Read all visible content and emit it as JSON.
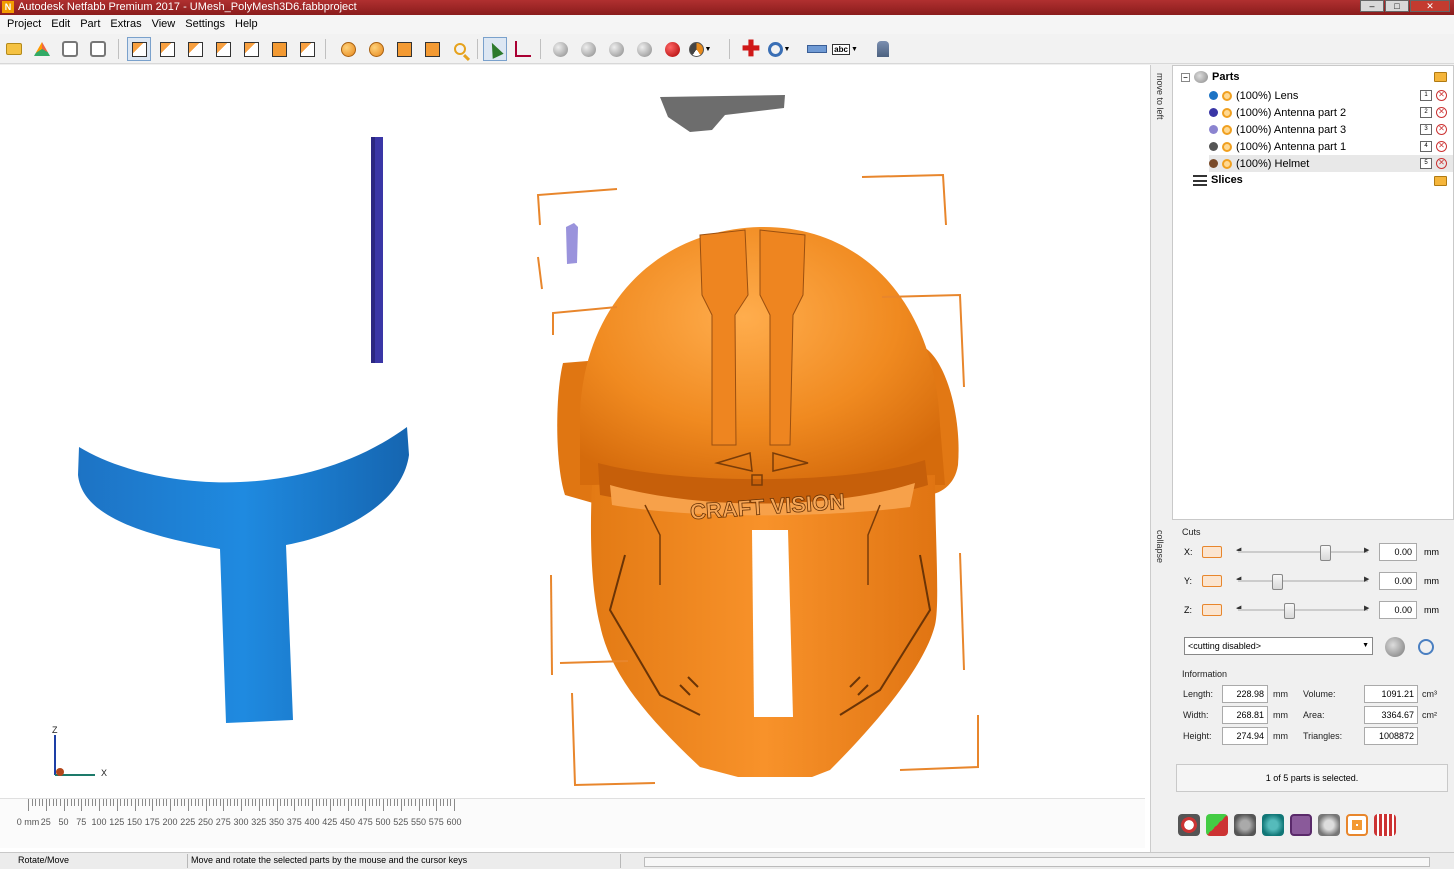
{
  "window": {
    "title": "Autodesk Netfabb Premium 2017 - UMesh_PolyMesh3D6.fabbproject",
    "app_icon_letter": "N"
  },
  "menu": [
    "Project",
    "Edit",
    "Part",
    "Extras",
    "View",
    "Settings",
    "Help"
  ],
  "toolbar_icons": [
    "open-project-icon",
    "add-part-icon",
    "settings-box-icon",
    "add-box-icon",
    "view-front-icon",
    "view-back-icon",
    "view-left-icon",
    "view-right-icon",
    "view-top-icon",
    "view-bottom-icon",
    "view-iso-icon",
    "repair-ball-icon",
    "sphere-icon",
    "fit-icon",
    "fit-selection-icon",
    "zoom-icon",
    "select-pointer-icon",
    "axes-icon",
    "shadow-sphere-icon",
    "gray-sphere-icon",
    "multi-sphere-icon",
    "mesh-sphere-icon",
    "color-spheres-icon",
    "pie-view-icon",
    "add-red-cross-icon",
    "dial-icon",
    "ruler-icon",
    "label-abc-icon",
    "person-icon"
  ],
  "side_strip": {
    "move_to_left": "move to left",
    "collapse": "collapse"
  },
  "tree": {
    "parts_label": "Parts",
    "slices_label": "Slices",
    "parts": [
      {
        "label": "(100%) Lens",
        "color": "#1d73c4",
        "index": "1"
      },
      {
        "label": "(100%) Antenna part 2",
        "color": "#3a36a6",
        "index": "2"
      },
      {
        "label": "(100%) Antenna part 3",
        "color": "#8b84d0",
        "index": "3"
      },
      {
        "label": "(100%) Antenna part 1",
        "color": "#555555",
        "index": "4"
      },
      {
        "label": "(100%) Helmet",
        "color": "#ef7f1a",
        "index": "5"
      }
    ],
    "selected_index": 4
  },
  "cuts": {
    "title": "Cuts",
    "unit": "mm",
    "rows": [
      {
        "axis": "X:",
        "value": "0.00",
        "position": 0.68
      },
      {
        "axis": "Y:",
        "value": "0.00",
        "position": 0.31
      },
      {
        "axis": "Z:",
        "value": "0.00",
        "position": 0.4
      }
    ],
    "mode": "<cutting disabled>"
  },
  "information": {
    "title": "Information",
    "length_label": "Length:",
    "length": "228.98",
    "width_label": "Width:",
    "width": "268.81",
    "height_label": "Height:",
    "height": "274.94",
    "volume_label": "Volume:",
    "volume": "1091.21",
    "area_label": "Area:",
    "area": "3364.67",
    "triangles_label": "Triangles:",
    "triangles": "1008872",
    "unit_mm": "mm",
    "unit_cm3": "cm³",
    "unit_cm2": "cm²"
  },
  "selection_status": "1 of 5 parts is selected.",
  "viewport": {
    "helmet_text": "CRAFT VISION",
    "axis_z": "Z",
    "axis_x": "X",
    "ruler_labels": [
      "0 mm",
      "25",
      "50",
      "75",
      "100",
      "125",
      "150",
      "175",
      "200",
      "225",
      "250",
      "275",
      "300",
      "325",
      "350",
      "375",
      "400",
      "425",
      "450",
      "475",
      "500",
      "525",
      "550",
      "575",
      "600"
    ]
  },
  "statusbar": {
    "mode": "Rotate/Move",
    "hint": "Move and rotate the selected parts by the mouse and the cursor keys"
  },
  "colors": {
    "helmet": "#ef7f1a",
    "lens": "#1d73c4",
    "selection": "#e8862c"
  }
}
